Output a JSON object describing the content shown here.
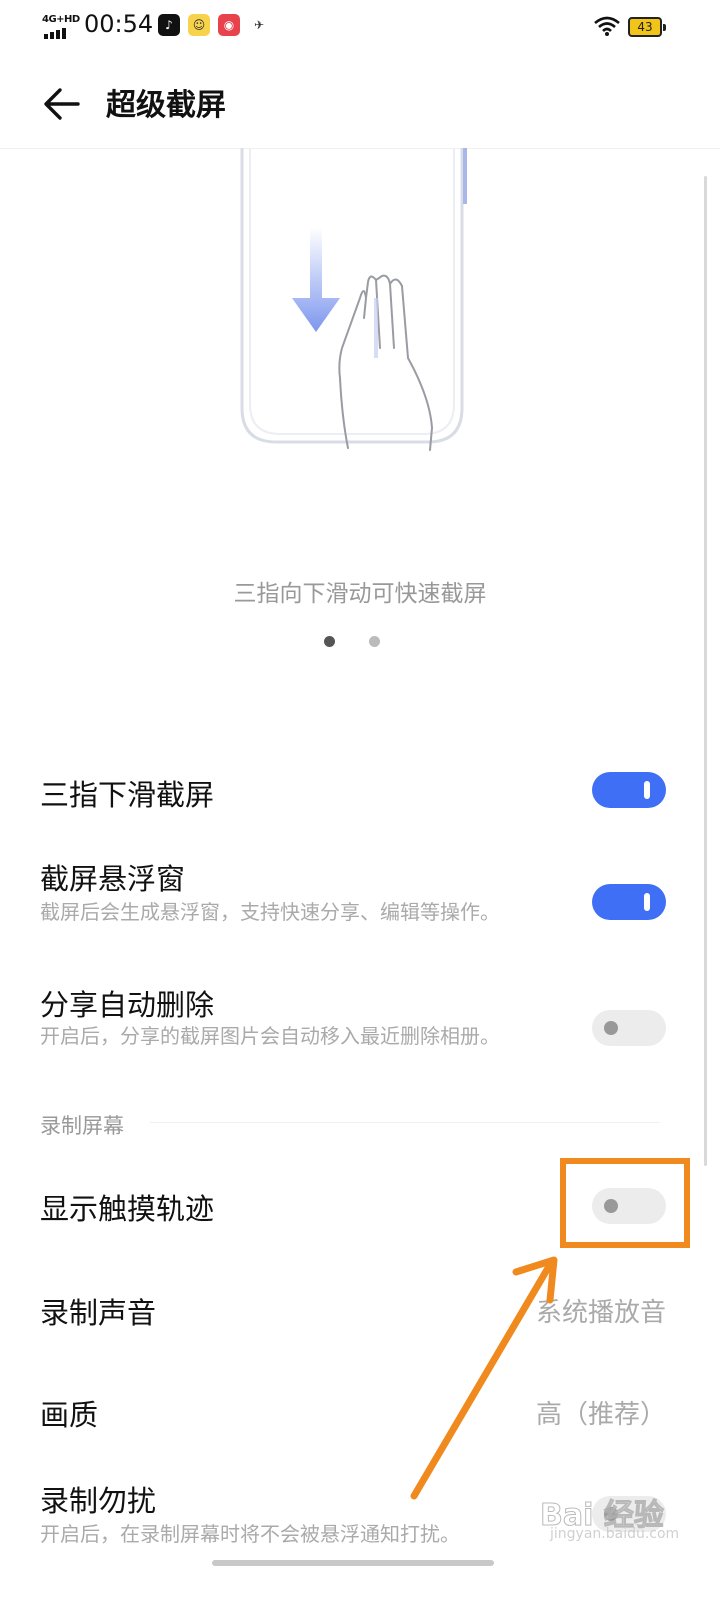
{
  "status_bar": {
    "network": "4G+HD",
    "time": "00:54",
    "battery": "43",
    "app_icons": [
      "tiktok-icon",
      "qq-browser-icon",
      "kuaishou-icon",
      "bird-app-icon"
    ]
  },
  "header": {
    "title": "超级截屏"
  },
  "illustration": {
    "caption": "三指向下滑动可快速截屏",
    "page_count": 2,
    "active_page": 1
  },
  "settings": {
    "three_finger": {
      "title": "三指下滑截屏",
      "enabled": true
    },
    "floating_window": {
      "title": "截屏悬浮窗",
      "desc": "截屏后会生成悬浮窗，支持快速分享、编辑等操作。",
      "enabled": true
    },
    "auto_delete": {
      "title": "分享自动删除",
      "desc": "开启后，分享的截屏图片会自动移入最近删除相册。",
      "enabled": false
    }
  },
  "recording": {
    "section_title": "录制屏幕",
    "touch_trace": {
      "title": "显示触摸轨迹",
      "enabled": false
    },
    "sound": {
      "title": "录制声音",
      "value": "系统播放音"
    },
    "quality": {
      "title": "画质",
      "value": "高（推荐）"
    },
    "dnd": {
      "title": "录制勿扰",
      "desc": "开启后，在录制屏幕时将不会被悬浮通知打扰。"
    }
  },
  "watermark": {
    "text": "Bai 经验",
    "sub": "jingyan.baidu.com"
  },
  "colors": {
    "accent": "#3e6ff4",
    "highlight": "#f18a1e",
    "text_primary": "#111111",
    "text_secondary": "#aaaaaa"
  }
}
